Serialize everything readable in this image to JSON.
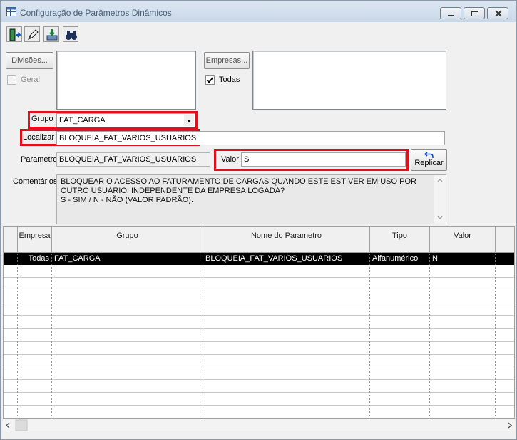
{
  "window": {
    "title": "Configuração de Parâmetros Dinâmicos"
  },
  "toolbar": {
    "buttons": [
      {
        "name": "exit",
        "icon": "exit-door-icon"
      },
      {
        "name": "edit",
        "icon": "pencil-icon"
      },
      {
        "name": "import",
        "icon": "tray-import-icon"
      },
      {
        "name": "search",
        "icon": "binoculars-icon"
      }
    ]
  },
  "divisoes": {
    "button_label": "Divisões...",
    "geral_label": "Geral",
    "geral_checked": false
  },
  "empresas": {
    "button_label": "Empresas...",
    "todas_label": "Todas",
    "todas_checked": true
  },
  "form": {
    "grupo_label": "Grupo",
    "grupo_value": "FAT_CARGA",
    "localizar_label": "Localizar",
    "localizar_value": "BLOQUEIA_FAT_VARIOS_USUARIOS",
    "parametro_label": "Parametro",
    "parametro_value": "BLOQUEIA_FAT_VARIOS_USUARIOS",
    "valor_label": "Valor",
    "valor_value": "S",
    "replicar_label": "Replicar",
    "comentarios_label": "Comentários",
    "comentarios_lines": [
      "BLOQUEAR O ACESSO AO FATURAMENTO DE CARGAS QUANDO ESTE ESTIVER EM USO POR",
      "OUTRO USUÁRIO, INDEPENDENTE DA EMPRESA LOGADA?",
      "S - SIM / N - NÃO (VALOR PADRÃO)."
    ]
  },
  "grid": {
    "columns": [
      "Empresa",
      "Grupo",
      "Nome do Parametro",
      "Tipo",
      "Valor"
    ],
    "rows": [
      {
        "empresa": "Todas",
        "grupo": "FAT_CARGA",
        "parametro": "BLOQUEIA_FAT_VARIOS_USUARIOS",
        "tipo": "Alfanumérico",
        "valor": "N"
      }
    ]
  },
  "colors": {
    "highlight_border": "#e0101c",
    "selected_row": "#000000"
  }
}
